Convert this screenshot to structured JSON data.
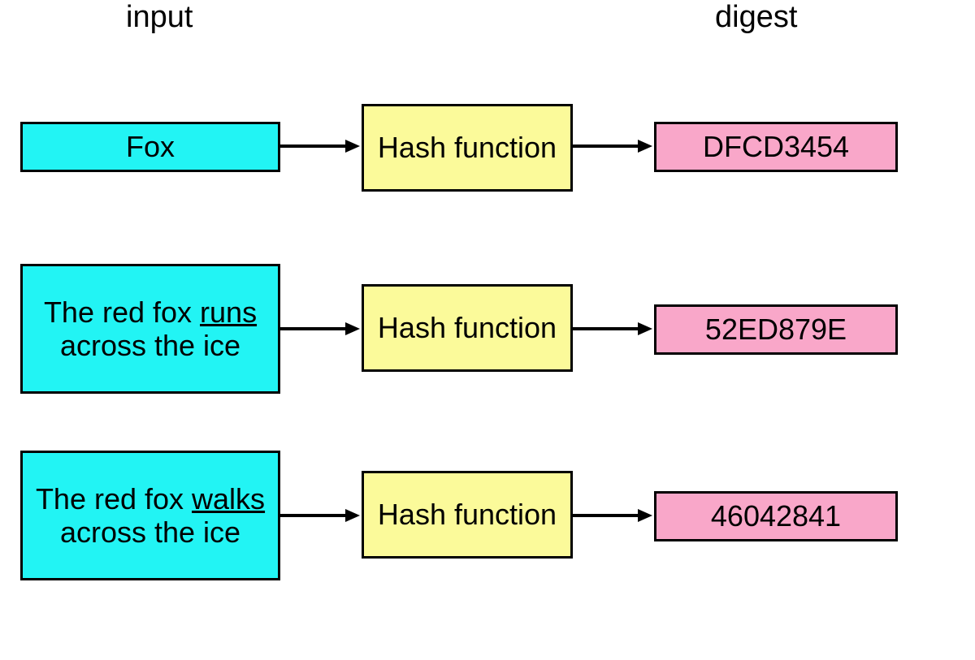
{
  "headers": {
    "input": "input",
    "digest": "digest"
  },
  "rows": [
    {
      "input_pre": "",
      "input_underlined": "",
      "input_post": "Fox",
      "input_single_line": true,
      "func": "Hash function",
      "digest": "DFCD3454"
    },
    {
      "input_pre": "The red fox ",
      "input_underlined": "runs",
      "input_post": " across the ice",
      "input_single_line": false,
      "func": "Hash function",
      "digest": "52ED879E"
    },
    {
      "input_pre": "The red fox ",
      "input_underlined": "walks ",
      "input_post": "across the ice",
      "input_single_line": false,
      "func": "Hash function",
      "digest": "46042841"
    }
  ],
  "colors": {
    "input_box": "#22f4f4",
    "func_box": "#fbfa9a",
    "digest_box": "#f9a7c9"
  }
}
